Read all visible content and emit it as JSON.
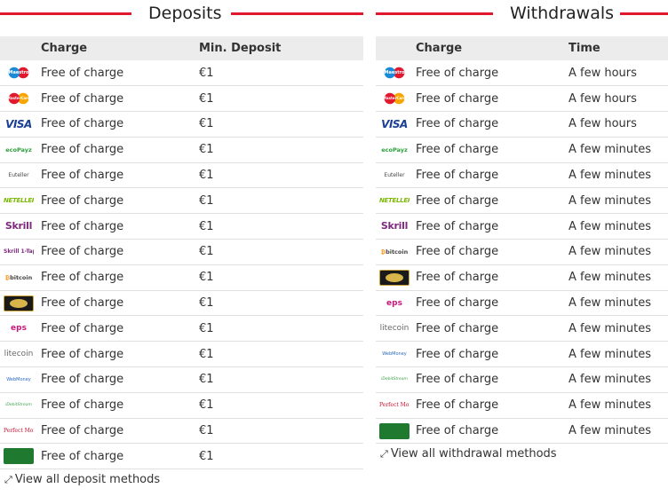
{
  "deposits": {
    "title": "Deposits",
    "columns": [
      "",
      "Charge",
      "Min. Deposit"
    ],
    "rows": [
      {
        "logo": "Maestro",
        "icon": "maestro-logo",
        "charge": "Free of charge",
        "value": "€1"
      },
      {
        "logo": "MasterCard",
        "icon": "mastercard-logo",
        "charge": "Free of charge",
        "value": "€1"
      },
      {
        "logo": "VISA",
        "icon": "visa-logo",
        "charge": "Free of charge",
        "value": "€1"
      },
      {
        "logo": "ecoPayz",
        "icon": "ecopayz-logo",
        "charge": "Free of charge",
        "value": "€1"
      },
      {
        "logo": "Euteller",
        "icon": "euteller-logo",
        "charge": "Free of charge",
        "value": "€1"
      },
      {
        "logo": "NETELLER",
        "icon": "neteller-logo",
        "charge": "Free of charge",
        "value": "€1"
      },
      {
        "logo": "Skrill",
        "icon": "skrill-logo",
        "charge": "Free of charge",
        "value": "€1"
      },
      {
        "logo": "Skrill 1-Tap",
        "icon": "skrill-1tap-logo",
        "charge": "Free of charge",
        "value": "€1"
      },
      {
        "logo": "bitcoin",
        "icon": "bitcoin-logo",
        "charge": "Free of charge",
        "value": "€1"
      },
      {
        "logo": "",
        "icon": "dark-card-logo",
        "charge": "Free of charge",
        "value": "€1"
      },
      {
        "logo": "eps",
        "icon": "eps-logo",
        "charge": "Free of charge",
        "value": "€1"
      },
      {
        "logo": "litecoin",
        "icon": "litecoin-logo",
        "charge": "Free of charge",
        "value": "€1"
      },
      {
        "logo": "WebMoney",
        "icon": "webmoney-logo",
        "charge": "Free of charge",
        "value": "€1"
      },
      {
        "logo": "iDebitStream",
        "icon": "stream-logo",
        "charge": "Free of charge",
        "value": "€1"
      },
      {
        "logo": "Perfect Money",
        "icon": "perfect-money-logo",
        "charge": "Free of charge",
        "value": "€1"
      },
      {
        "logo": "",
        "icon": "green-card-logo",
        "charge": "Free of charge",
        "value": "€1"
      }
    ],
    "link": "View all deposit methods"
  },
  "withdrawals": {
    "title": "Withdrawals",
    "columns": [
      "",
      "Charge",
      "Time"
    ],
    "rows": [
      {
        "logo": "Maestro",
        "icon": "maestro-logo",
        "charge": "Free of charge",
        "value": "A few hours"
      },
      {
        "logo": "MasterCard",
        "icon": "mastercard-logo",
        "charge": "Free of charge",
        "value": "A few hours"
      },
      {
        "logo": "VISA",
        "icon": "visa-logo",
        "charge": "Free of charge",
        "value": "A few hours"
      },
      {
        "logo": "ecoPayz",
        "icon": "ecopayz-logo",
        "charge": "Free of charge",
        "value": "A few minutes"
      },
      {
        "logo": "Euteller",
        "icon": "euteller-logo",
        "charge": "Free of charge",
        "value": "A few minutes"
      },
      {
        "logo": "NETELLER",
        "icon": "neteller-logo",
        "charge": "Free of charge",
        "value": "A few minutes"
      },
      {
        "logo": "Skrill",
        "icon": "skrill-logo",
        "charge": "Free of charge",
        "value": "A few minutes"
      },
      {
        "logo": "bitcoin",
        "icon": "bitcoin-logo",
        "charge": "Free of charge",
        "value": "A few minutes"
      },
      {
        "logo": "",
        "icon": "dark-card-logo",
        "charge": "Free of charge",
        "value": "A few minutes"
      },
      {
        "logo": "eps",
        "icon": "eps-logo",
        "charge": "Free of charge",
        "value": "A few minutes"
      },
      {
        "logo": "litecoin",
        "icon": "litecoin-logo",
        "charge": "Free of charge",
        "value": "A few minutes"
      },
      {
        "logo": "WebMoney",
        "icon": "webmoney-logo",
        "charge": "Free of charge",
        "value": "A few minutes"
      },
      {
        "logo": "iDebitStream",
        "icon": "stream-logo",
        "charge": "Free of charge",
        "value": "A few minutes"
      },
      {
        "logo": "Perfect Money",
        "icon": "perfect-money-logo",
        "charge": "Free of charge",
        "value": "A few minutes"
      },
      {
        "logo": "",
        "icon": "green-card-logo",
        "charge": "Free of charge",
        "value": "A few minutes"
      }
    ],
    "link": "View all withdrawal methods"
  },
  "colors": {
    "accent": "#e0192e",
    "header_bg": "#ececec"
  }
}
